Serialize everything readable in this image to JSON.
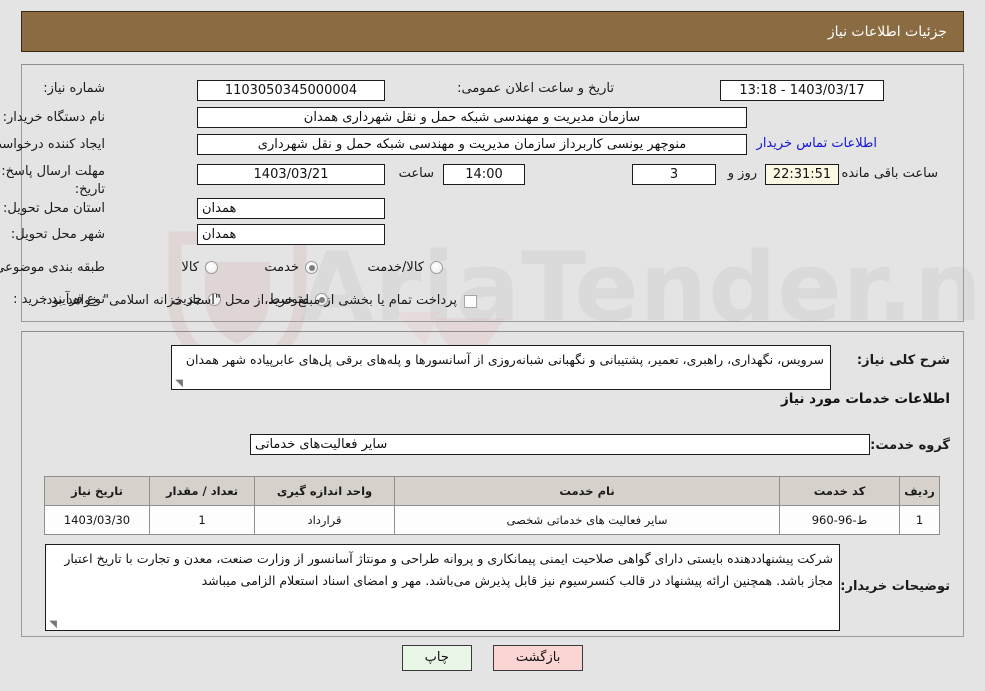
{
  "header": {
    "title": "جزئیات اطلاعات نیاز"
  },
  "form": {
    "need_number_label": "شماره نیاز:",
    "need_number_value": "1103050345000004",
    "announce_datetime_label": "تاریخ و ساعت اعلان عمومی:",
    "announce_datetime_value": "1403/03/17 - 13:18",
    "buyer_org_label": "نام دستگاه خریدار:",
    "buyer_org_value": "سازمان مدیریت و مهندسی شبکه حمل و نقل شهرداری همدان",
    "requester_label": "ایجاد کننده درخواست:",
    "requester_value": "منوچهر یونسی کاربرداز سازمان مدیریت و مهندسی شبکه حمل و نقل شهرداری",
    "buyer_contact_link": "اطلاعات تماس خریدار",
    "deadline_label_line1": "مهلت ارسال پاسخ: تا",
    "deadline_label_line2": "تاریخ:",
    "deadline_date": "1403/03/21",
    "deadline_hour_label": "ساعت",
    "deadline_hour": "14:00",
    "remaining_days": "3",
    "remaining_days_label": "روز و",
    "remaining_time": "22:31:51",
    "remaining_time_label": "ساعت باقی مانده",
    "province_label": "استان محل تحویل:",
    "province_value": "همدان",
    "city_label": "شهر محل تحویل:",
    "city_value": "همدان",
    "category_label": "طبقه بندی موضوعی:",
    "category_options": [
      "کالا",
      "خدمت",
      "کالا/خدمت"
    ],
    "category_selected": "خدمت",
    "purchase_type_label": "نوع فرآیند خرید :",
    "purchase_type_options": [
      "جزیی",
      "متوسط"
    ],
    "purchase_type_selected": "متوسط",
    "treasury_checkbox_checked": false,
    "treasury_note": "پرداخت تمام یا بخشی از مبلغ خرید،از محل \"اسناد خزانه اسلامی\" خواهد بود."
  },
  "description": {
    "need_summary_label": "شرح کلی نیاز:",
    "need_summary_value": "سرویس، نگهداری، راهبری، تعمیر، پشتیبانی و نگهبانی شبانه‌روزی از آسانسورها و پله‌های برقی پل‌های عابرپیاده شهر همدان",
    "services_section_title": "اطلاعات خدمات مورد نیاز",
    "service_group_label": "گروه خدمت:",
    "service_group_value": "سایر فعالیت‌های خدماتی"
  },
  "table": {
    "columns": [
      "ردیف",
      "کد خدمت",
      "نام خدمت",
      "واحد اندازه گیری",
      "تعداد / مقدار",
      "تاریخ نیاز"
    ],
    "rows": [
      {
        "index": "1",
        "code": "ط-96-960",
        "name": "سایر فعالیت های خدماتی شخصی",
        "unit": "قرارداد",
        "quantity": "1",
        "need_date": "1403/03/30"
      }
    ]
  },
  "buyer_notes": {
    "label": "توضیحات خریدار:",
    "text": "شرکت پیشنهاددهنده بایستی دارای گواهی صلاحیت ایمنی پیمانکاری و پروانه طراحی و مونتاژ آسانسور از وزارت صنعت، معدن و تجارت با تاریخ اعتبار مجاز باشد. همچنین ارائه پیشنهاد در قالب کنسرسیوم نیز قابل پذیرش می‌باشد. مهر و امضای اسناد استعلام الزامی میباشد"
  },
  "footer": {
    "print_label": "چاپ",
    "back_label": "بازگشت"
  },
  "watermark": {
    "text": "AriaTender.net"
  },
  "colors": {
    "header_bg": "#8b6b42",
    "page_bg": "#e4e4e4",
    "link": "#1414d2",
    "table_header_bg": "#d6d2cb",
    "print_btn_bg": "#e9f7e6",
    "back_btn_bg": "#fbd4d4",
    "countdown_bg": "#fbf8e3"
  }
}
